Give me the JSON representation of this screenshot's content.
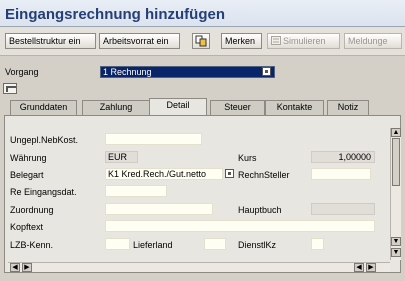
{
  "window": {
    "title": "Eingangsrechnung hinzufügen"
  },
  "toolbar": {
    "bestellstruktur": "Bestellstruktur ein",
    "arbeitsvorrat": "Arbeitsvorrat ein",
    "merken": "Merken",
    "simulieren": "Simulieren",
    "meldungen": "Meldunge"
  },
  "vorgang": {
    "label": "Vorgang",
    "value": "1 Rechnung"
  },
  "tabs": [
    "Grunddaten",
    "Zahlung",
    "Detail",
    "Steuer",
    "Kontakte",
    "Notiz"
  ],
  "active_tab": "Detail",
  "detail": {
    "ungepl_label": "Ungepl.NebKost.",
    "waehrung_label": "Währung",
    "waehrung_value": "EUR",
    "kurs_label": "Kurs",
    "kurs_value": "1,00000",
    "belegart_label": "Belegart",
    "belegart_value": "K1 Kred.Rech./Gut.netto",
    "rechnsteller_label": "RechnSteller",
    "reeingang_label": "Re Eingangsdat.",
    "zuordnung_label": "Zuordnung",
    "hauptbuch_label": "Hauptbuch",
    "kopftext_label": "Kopftext",
    "lzb_label": "LZB-Kenn.",
    "lieferland_label": "Lieferland",
    "dienstlkz_label": "DienstlKz"
  }
}
